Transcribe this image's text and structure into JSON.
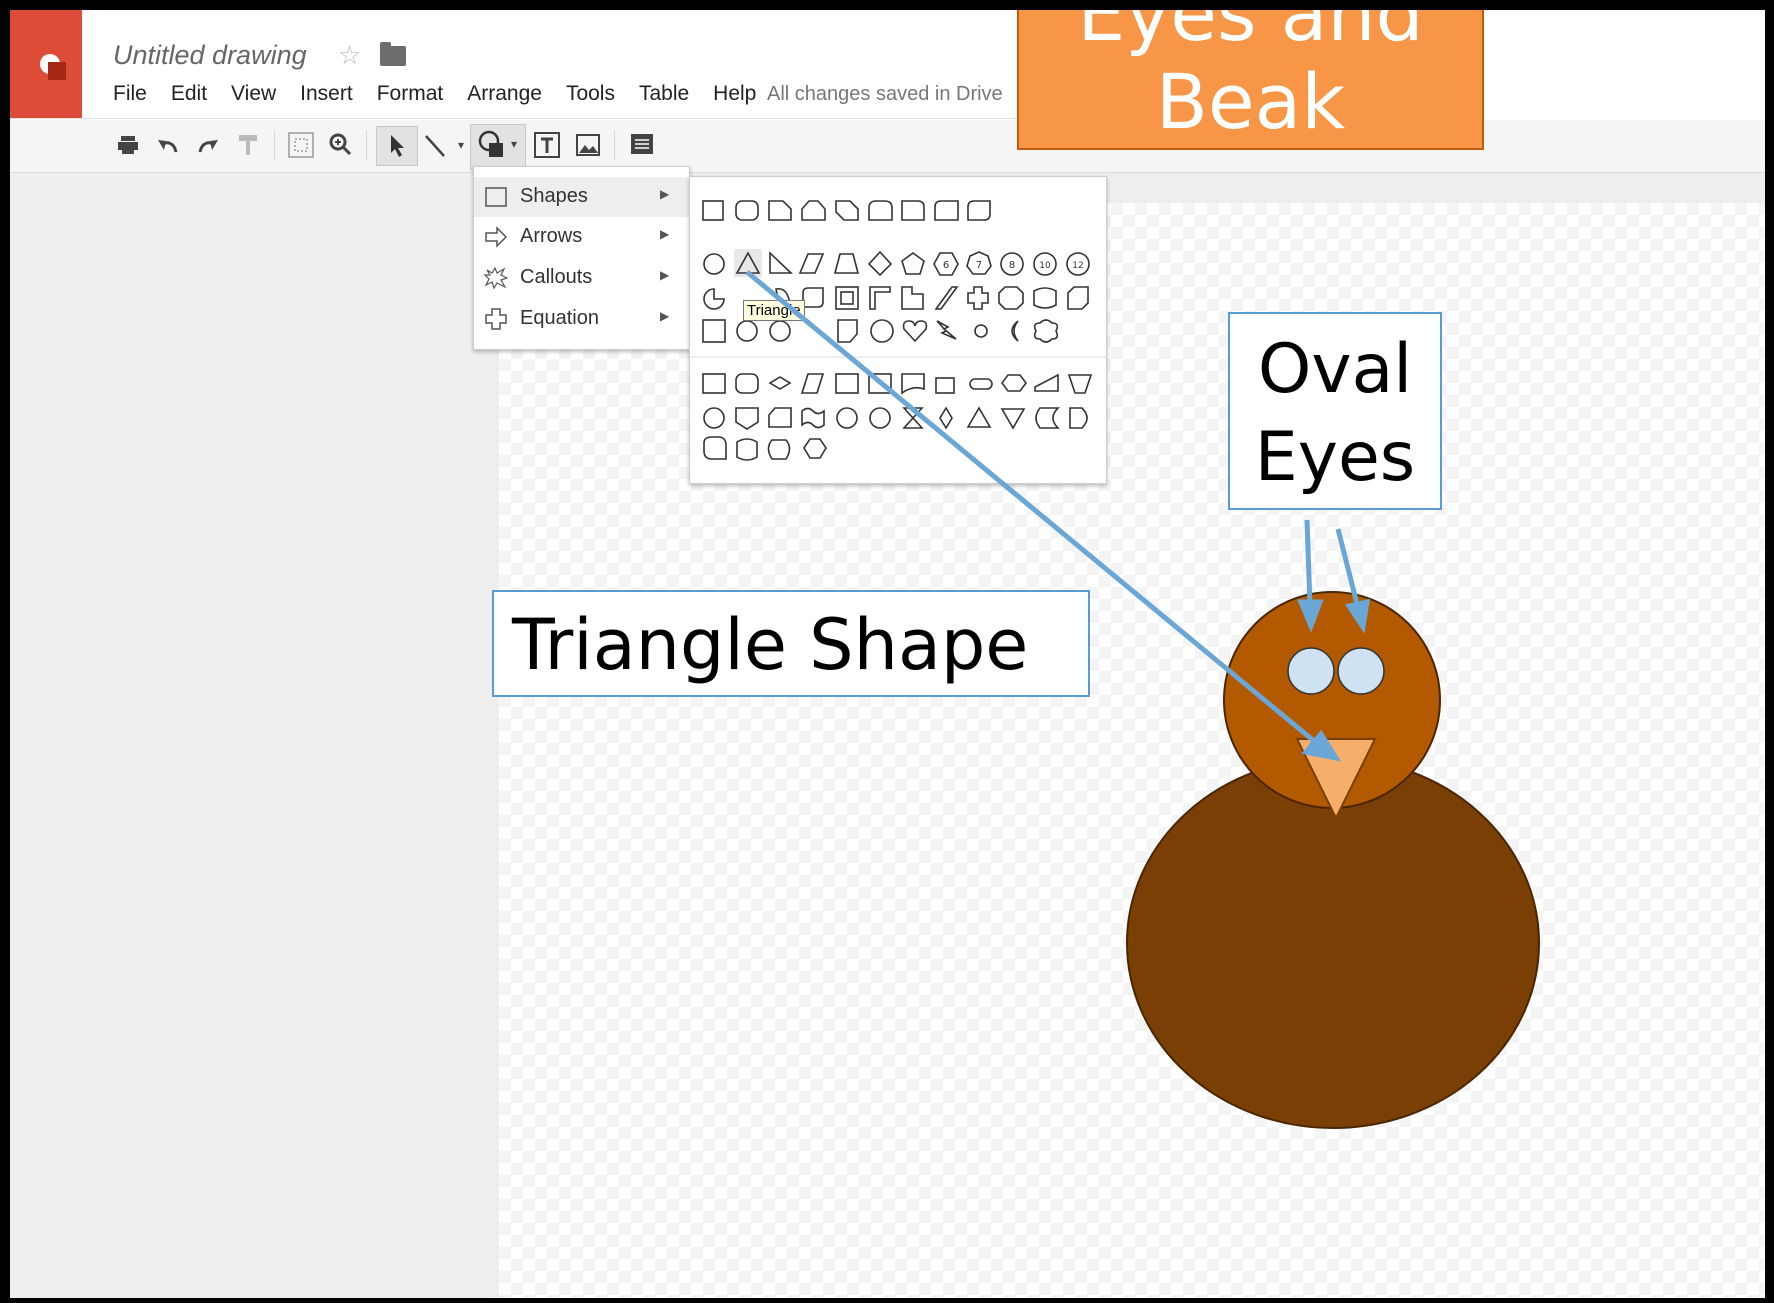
{
  "app": {
    "title": "Untitled drawing",
    "status": "All changes saved in Drive",
    "menus": [
      "File",
      "Edit",
      "View",
      "Insert",
      "Format",
      "Arrange",
      "Tools",
      "Table",
      "Help"
    ]
  },
  "toolbar": {
    "icons": [
      "print-icon",
      "undo-icon",
      "redo-icon",
      "paint-format-icon",
      "zoom-fit-icon",
      "zoom-icon",
      "select-icon",
      "line-icon",
      "shape-icon",
      "text-box-icon",
      "image-icon",
      "comment-icon"
    ]
  },
  "shape_menu": {
    "items": [
      {
        "label": "Shapes",
        "icon": "square-outline-icon",
        "highlighted": true
      },
      {
        "label": "Arrows",
        "icon": "arrow-icon",
        "highlighted": false
      },
      {
        "label": "Callouts",
        "icon": "explosion-icon",
        "highlighted": false
      },
      {
        "label": "Equation",
        "icon": "plus-icon",
        "highlighted": false
      }
    ],
    "tooltip": "Triangle",
    "circle_numbers": [
      "6",
      "7",
      "8",
      "10",
      "12"
    ]
  },
  "annotations": {
    "triangle_shape": "Triangle Shape",
    "oval_eyes_line1": "Oval",
    "oval_eyes_line2": "Eyes",
    "eyes_beak_line1": "Eyes and",
    "eyes_beak_line2": "Beak"
  },
  "colors": {
    "logo_red": "#dd4b39",
    "callout_border": "#5b9bd5",
    "arrow_blue": "#6aa6d6",
    "orange_box": "#f79646",
    "turkey_head": "#b35a00",
    "turkey_body": "#7a3f05",
    "turkey_eye": "#cfe2f3",
    "turkey_beak": "#f6ae6b"
  }
}
